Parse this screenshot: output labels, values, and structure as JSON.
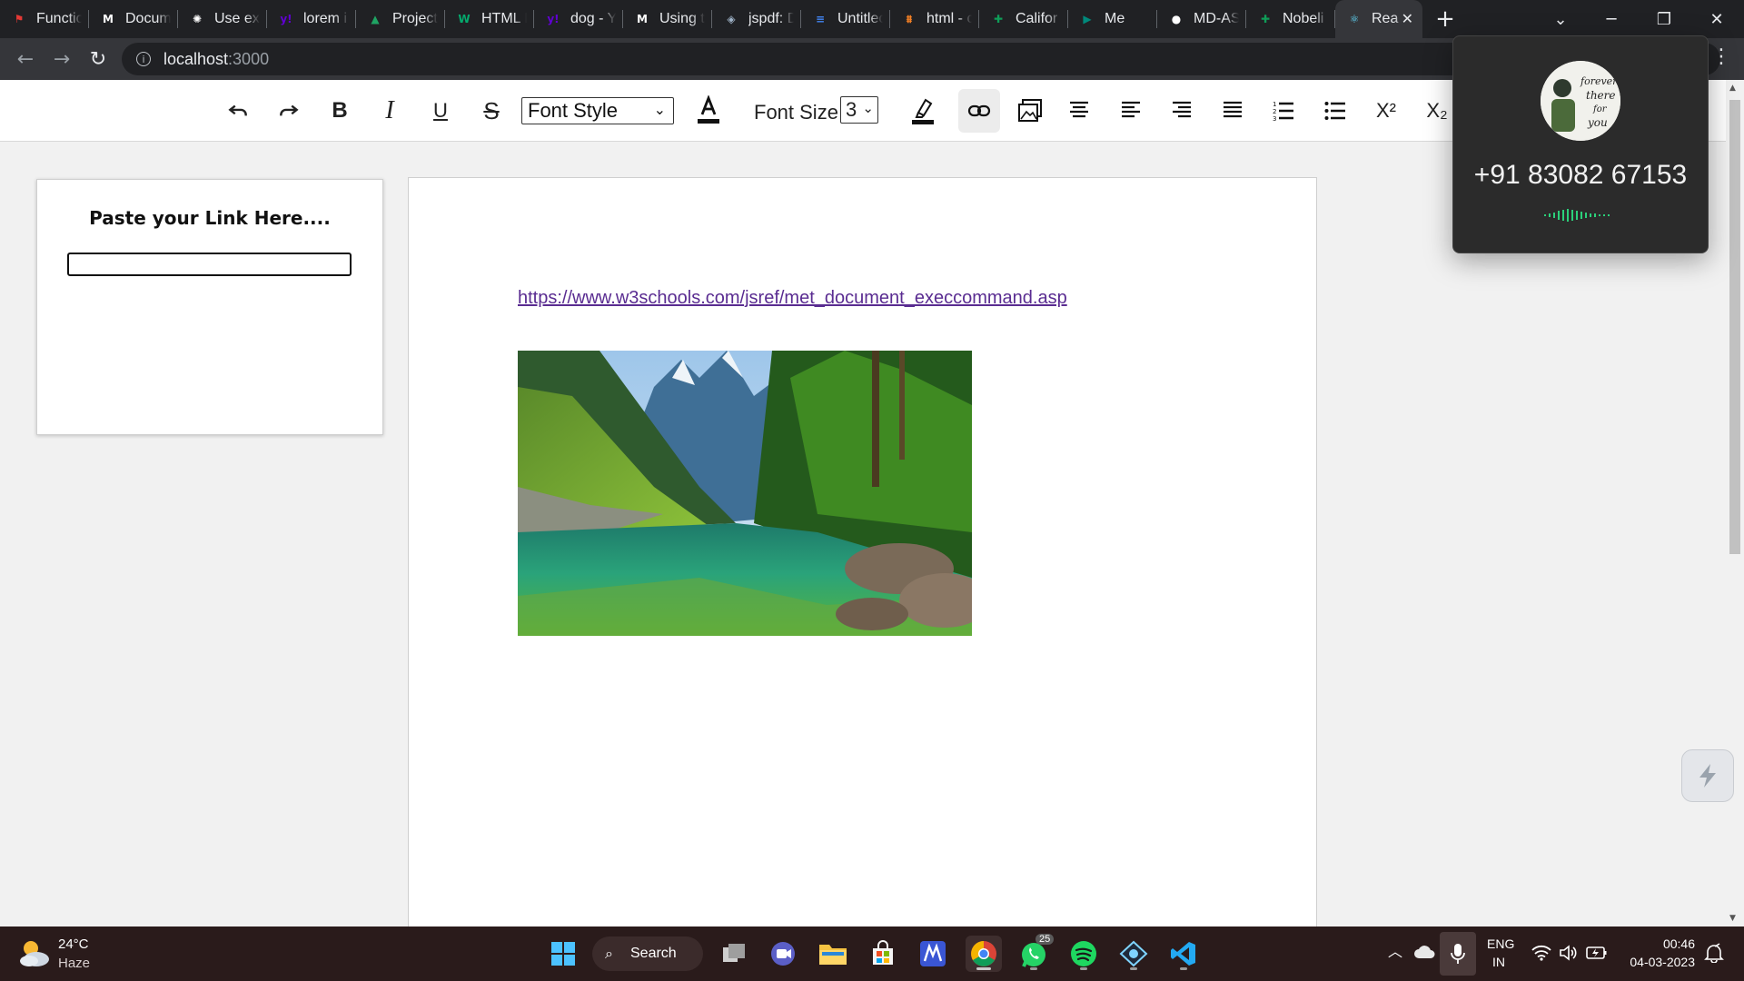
{
  "browser": {
    "tabs": [
      {
        "title": "Functio",
        "icon": "red-brand-icon",
        "color": "#e53935"
      },
      {
        "title": "Docum",
        "icon": "medium-icon",
        "color": "#ffffff"
      },
      {
        "title": "Use exe",
        "icon": "openai-icon",
        "color": "#ffffff"
      },
      {
        "title": "lorem i",
        "icon": "yahoo-icon",
        "color": "#6001d2"
      },
      {
        "title": "Project",
        "icon": "google-drive-icon",
        "color": "#1fa463"
      },
      {
        "title": "HTML D",
        "icon": "w3schools-icon",
        "color": "#04aa6d"
      },
      {
        "title": "dog - Y",
        "icon": "yahoo-icon",
        "color": "#6001d2"
      },
      {
        "title": "Using tl",
        "icon": "medium-icon",
        "color": "#ffffff"
      },
      {
        "title": "jspdf: D",
        "icon": "shield-icon",
        "color": "#9fb3c8"
      },
      {
        "title": "Untitlec",
        "icon": "google-docs-icon",
        "color": "#4285f4"
      },
      {
        "title": "html - c",
        "icon": "stackoverflow-icon",
        "color": "#f48024"
      },
      {
        "title": "Califor",
        "icon": "google-sheets-icon",
        "color": "#0f9d58"
      },
      {
        "title": "Me",
        "icon": "google-meet-icon",
        "color": "#00897b"
      },
      {
        "title": "MD-AS",
        "icon": "github-icon",
        "color": "#ffffff"
      },
      {
        "title": "Nobeli",
        "icon": "google-sheets-icon",
        "color": "#0f9d58"
      }
    ],
    "active_tab": {
      "title": "Rea",
      "icon": "react-icon",
      "color": "#61dafb"
    },
    "address": {
      "host": "localhost",
      "port": ":3000"
    }
  },
  "toolbar": {
    "font_style_label": "Font Style",
    "font_size_label": "Font Size",
    "font_size_value": "3",
    "superscript_label": "X²",
    "subscript_label": "X₂",
    "bold_label": "B",
    "italic_label": "I",
    "underline_label": "U",
    "strike_label": "S"
  },
  "link_panel": {
    "label": "Paste your Link Here....",
    "input_value": ""
  },
  "document": {
    "link_text": "https://www.w3schools.com/jsref/met_document_execcommand.asp"
  },
  "call_overlay": {
    "number": "+91 83082 67153",
    "avatar_text": [
      "forever",
      "there",
      "for",
      "you"
    ]
  },
  "taskbar": {
    "weather_temp": "24°C",
    "weather_condition": "Haze",
    "search_label": "Search",
    "whatsapp_badge": "25",
    "language_line1": "ENG",
    "language_line2": "IN",
    "time": "00:46",
    "date": "04-03-2023"
  }
}
